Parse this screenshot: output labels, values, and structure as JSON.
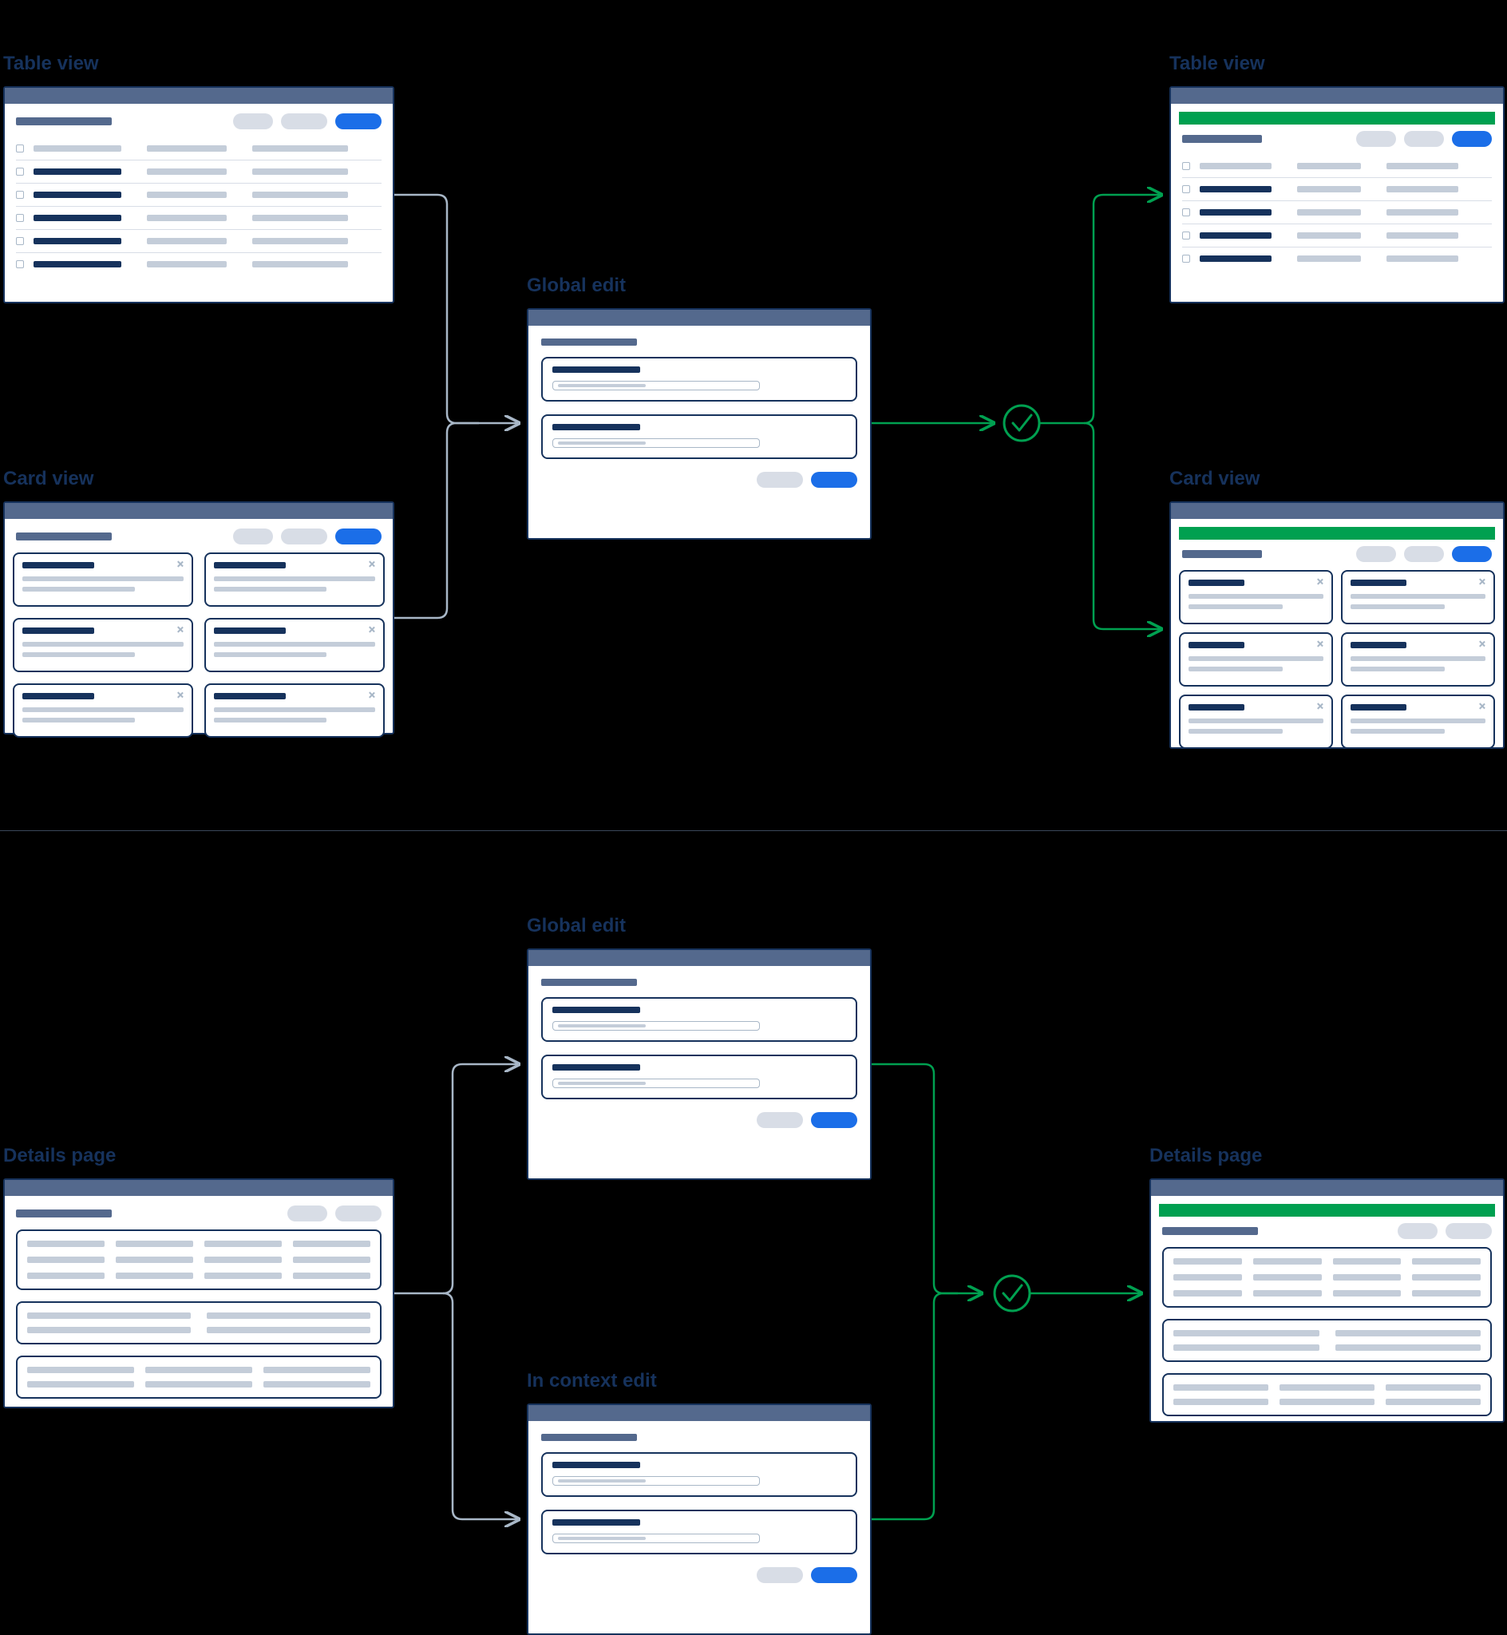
{
  "section1": {
    "labels": {
      "table_view_left": "Table view",
      "card_view_left": "Card view",
      "global_edit": "Global edit",
      "table_view_right": "Table view",
      "card_view_right": "Card view"
    }
  },
  "section2": {
    "labels": {
      "details_left": "Details page",
      "global_edit": "Global edit",
      "in_context_edit": "In context edit",
      "details_right": "Details page"
    }
  },
  "colors": {
    "label": "#16325c",
    "success": "#00a050",
    "connector_gray": "#a8b7c7",
    "connector_green": "#00a050",
    "blue": "#1b6ee8"
  }
}
